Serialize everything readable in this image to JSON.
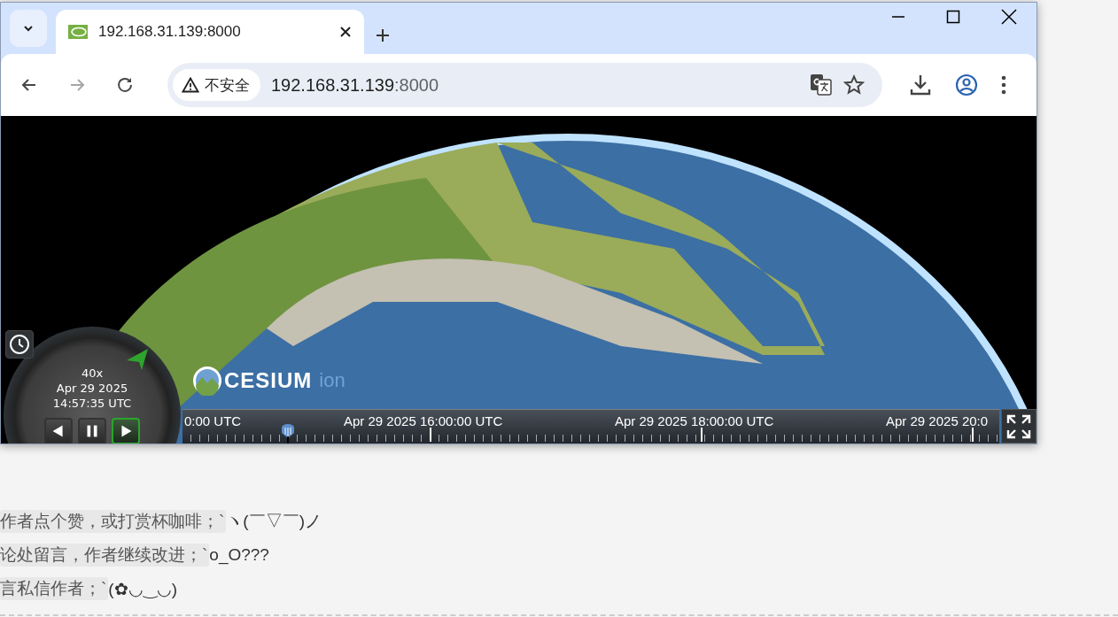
{
  "browser": {
    "tab": {
      "title": "192.168.31.139:8000"
    },
    "nav_buttons": [
      {
        "kind": "back",
        "disabled": false
      },
      {
        "kind": "forward",
        "disabled": true
      },
      {
        "kind": "reload",
        "disabled": false
      }
    ],
    "address_bar": {
      "security_label": "不安全",
      "url_host": "192.168.31.139",
      "url_port": ":8000"
    }
  },
  "viewer": {
    "animation": {
      "speed": "40x",
      "date": "Apr 29 2025",
      "time": "14:57:35 UTC",
      "buttons": [
        {
          "kind": "reverse",
          "selected": false
        },
        {
          "kind": "pause",
          "selected": false
        },
        {
          "kind": "play",
          "selected": true
        }
      ]
    },
    "logo": {
      "name": "CESIUM",
      "suffix": "ion"
    },
    "timeline": {
      "labels": [
        "0:00 UTC",
        "Apr 29 2025 16:00:00 UTC",
        "Apr 29 2025 18:00:00 UTC",
        "Apr 29 2025 20:0"
      ]
    }
  },
  "page_lines": [
    {
      "code": "作者点个赞，或打赏杯咖啡；`",
      "text": "ヽ(￣▽￣)ノ"
    },
    {
      "code": "论处留言，作者继续改进；`",
      "text": "o_O???"
    },
    {
      "code": "言私信作者；`",
      "text": "(✿◡‿◡)"
    }
  ]
}
